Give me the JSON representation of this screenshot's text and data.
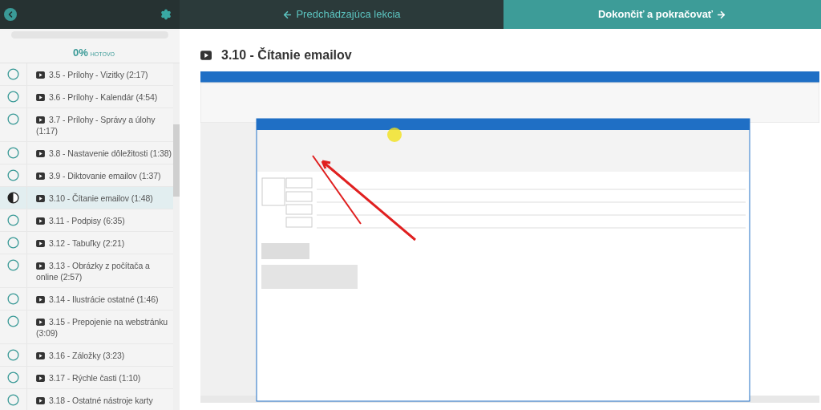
{
  "top_bar": {
    "previous_button": {
      "label": "Predchádzajúca lekcia"
    },
    "next_button": {
      "label": "Dokončiť a pokračovať"
    }
  },
  "sidebar": {
    "progress": {
      "level": 0,
      "percent": "0%",
      "label": "HOTOVO"
    },
    "lessons": [
      {
        "title": "3.5 - Prílohy - Vizitky (2:17)",
        "kind": "not_started",
        "selected": false
      },
      {
        "title": "3.6 - Prílohy - Kalendár (4:54)",
        "kind": "not_started",
        "selected": false
      },
      {
        "title": "3.7 - Prílohy - Správy a úlohy (1:17)",
        "kind": "not_started",
        "selected": false
      },
      {
        "title": "3.8 - Nastavenie dôležitosti (1:38)",
        "kind": "not_started",
        "selected": false
      },
      {
        "title": "3.9 - Diktovanie emailov (1:37)",
        "kind": "not_started",
        "selected": false
      },
      {
        "title": "3.10 - Čítanie emailov (1:48)",
        "kind": "in_progress",
        "selected": true
      },
      {
        "title": "3.11 - Podpisy (6:35)",
        "kind": "not_started",
        "selected": false
      },
      {
        "title": "3.12 - Tabuľky (2:21)",
        "kind": "not_started",
        "selected": false
      },
      {
        "title": "3.13 - Obrázky z počítača a online (2:57)",
        "kind": "not_started",
        "selected": false
      },
      {
        "title": "3.14 - Ilustrácie ostatné (1:46)",
        "kind": "not_started",
        "selected": false
      },
      {
        "title": "3.15 - Prepojenie na webstránku (3:09)",
        "kind": "not_started",
        "selected": false
      },
      {
        "title": "3.16 - Záložky (3:23)",
        "kind": "not_started",
        "selected": false
      },
      {
        "title": "3.17 - Rýchle časti (1:10)",
        "kind": "not_started",
        "selected": false
      },
      {
        "title": "3.18 - Ostatné nástroje karty",
        "kind": "not_started",
        "selected": false
      }
    ]
  },
  "lesson": {
    "title": "3.10 - Čítanie emailov"
  }
}
